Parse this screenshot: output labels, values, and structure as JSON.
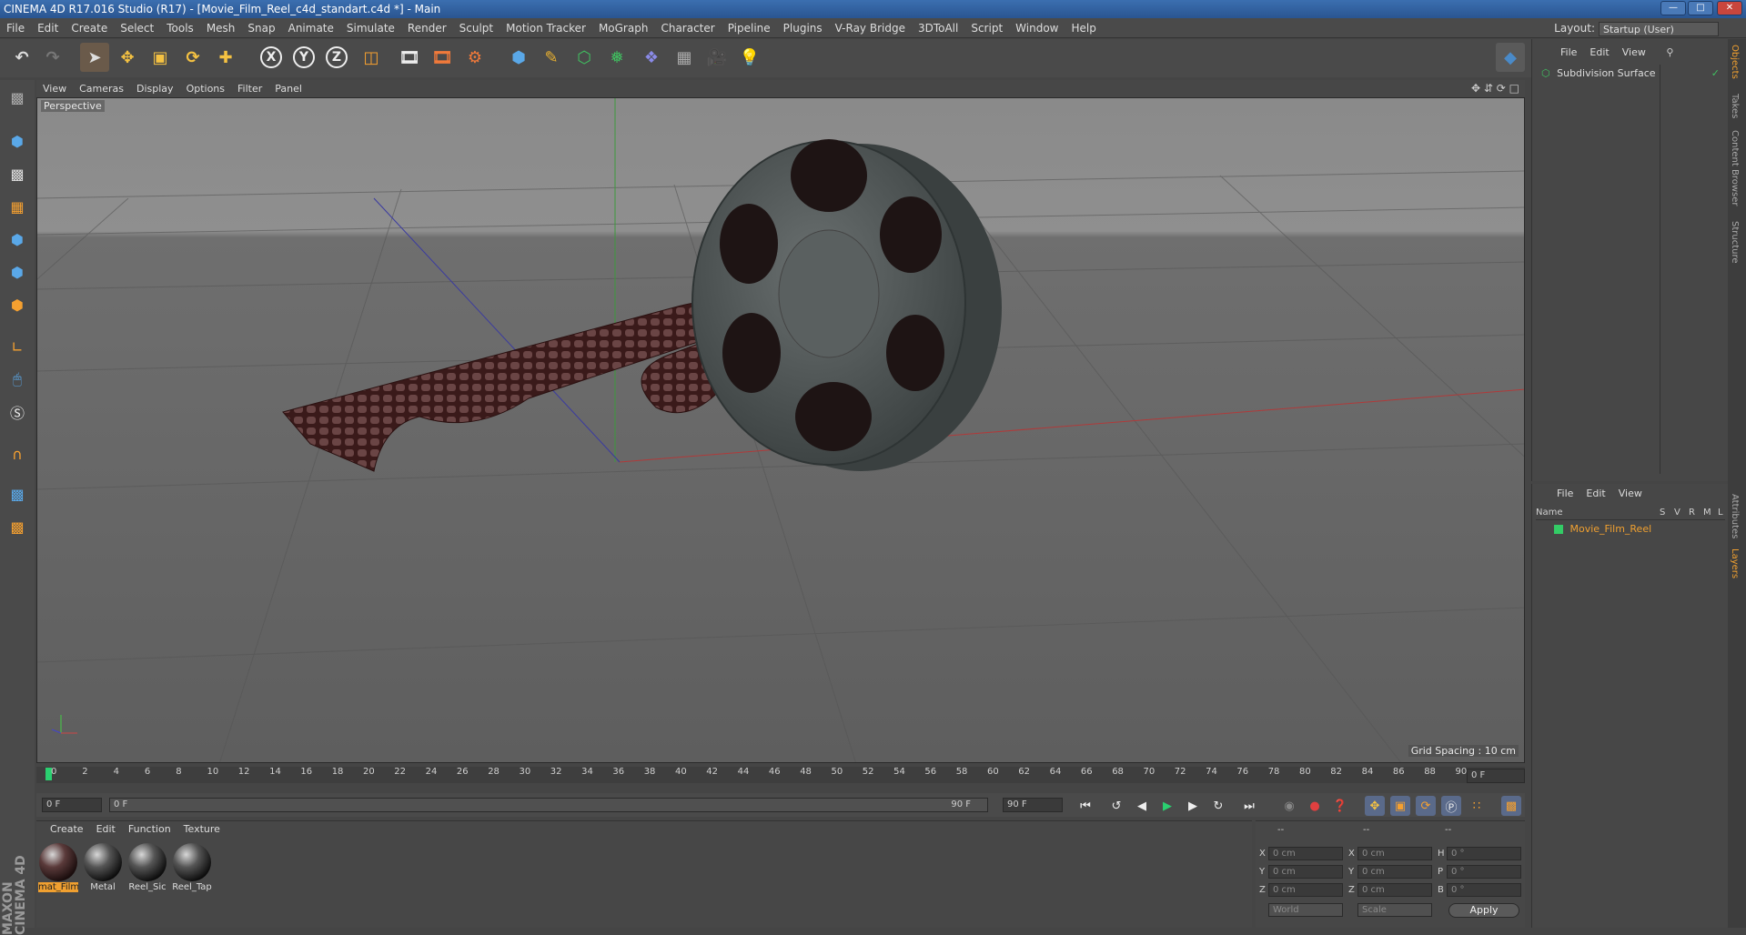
{
  "window": {
    "title": "CINEMA 4D R17.016 Studio (R17) - [Movie_Film_Reel_c4d_standart.c4d *] - Main"
  },
  "menubar": {
    "items": [
      "File",
      "Edit",
      "Create",
      "Select",
      "Tools",
      "Mesh",
      "Snap",
      "Animate",
      "Simulate",
      "Render",
      "Sculpt",
      "Motion Tracker",
      "MoGraph",
      "Character",
      "Pipeline",
      "Plugins",
      "V-Ray Bridge",
      "3DToAll",
      "Script",
      "Window",
      "Help"
    ]
  },
  "layout": {
    "label": "Layout:",
    "value": "Startup (User)"
  },
  "toolbar": {
    "axis_x": "X",
    "axis_y": "Y",
    "axis_z": "Z"
  },
  "viewport": {
    "menu": [
      "View",
      "Cameras",
      "Display",
      "Options",
      "Filter",
      "Panel"
    ],
    "label": "Perspective",
    "grid_spacing": "Grid Spacing : 10 cm"
  },
  "timeline": {
    "ticks": [
      "0",
      "2",
      "4",
      "6",
      "8",
      "10",
      "12",
      "14",
      "16",
      "18",
      "20",
      "22",
      "24",
      "26",
      "28",
      "30",
      "32",
      "34",
      "36",
      "38",
      "40",
      "42",
      "44",
      "46",
      "48",
      "50",
      "52",
      "54",
      "56",
      "58",
      "60",
      "62",
      "64",
      "66",
      "68",
      "70",
      "72",
      "74",
      "76",
      "78",
      "80",
      "82",
      "84",
      "86",
      "88",
      "90"
    ],
    "current_frame": "0 F"
  },
  "transport": {
    "start": "0 F",
    "range_start": "0 F",
    "range_end": "90 F",
    "end": "90 F"
  },
  "materials": {
    "menu": [
      "Create",
      "Edit",
      "Function",
      "Texture"
    ],
    "items": [
      {
        "label": "mat_Film",
        "selected": true
      },
      {
        "label": "Metal",
        "selected": false
      },
      {
        "label": "Reel_Sic",
        "selected": false
      },
      {
        "label": "Reel_Tap",
        "selected": false
      }
    ]
  },
  "coords": {
    "header": [
      "--",
      "--",
      "--"
    ],
    "rows": [
      {
        "l1": "X",
        "v1": "0 cm",
        "l2": "X",
        "v2": "0 cm",
        "l3": "H",
        "v3": "0 °"
      },
      {
        "l1": "Y",
        "v1": "0 cm",
        "l2": "Y",
        "v2": "0 cm",
        "l3": "P",
        "v3": "0 °"
      },
      {
        "l1": "Z",
        "v1": "0 cm",
        "l2": "Z",
        "v2": "0 cm",
        "l3": "B",
        "v3": "0 °"
      }
    ],
    "world": "World",
    "scale": "Scale",
    "apply": "Apply"
  },
  "objects": {
    "menu": [
      "File",
      "Edit",
      "View"
    ],
    "items": [
      "Subdivision Surface"
    ]
  },
  "layers": {
    "menu": [
      "File",
      "Edit",
      "View"
    ],
    "columns": [
      "Name",
      "S",
      "V",
      "R",
      "M",
      "L"
    ],
    "items": [
      "Movie_Film_Reel"
    ]
  },
  "sidetabs": [
    "Objects",
    "Takes",
    "Content Browser",
    "Structure",
    "Attributes",
    "Layers"
  ],
  "branding": "MAXON CINEMA 4D",
  "colors": {
    "accent": "#f0a030",
    "layer_green": "#33cc66",
    "title_blue": "#2a5591"
  }
}
